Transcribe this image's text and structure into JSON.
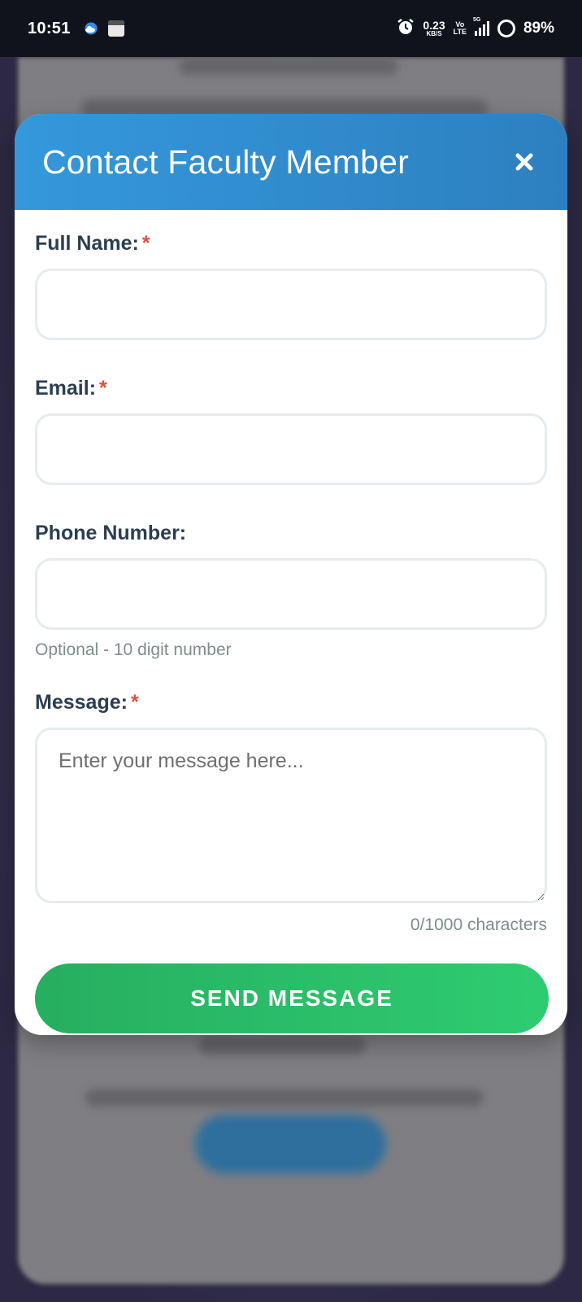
{
  "status_bar": {
    "time": "10:51",
    "net_speed_value": "0.23",
    "net_speed_unit": "KB/S",
    "volte_top": "Vo",
    "volte_bottom": "LTE",
    "signal_label": "5G",
    "battery": "89%",
    "icons": [
      "cloud-icon",
      "calendar-icon",
      "alarm-icon",
      "signal-icon",
      "battery-icon"
    ]
  },
  "modal": {
    "title": "Contact Faculty Member",
    "close_icon": "close-icon",
    "header_color": "#3498db",
    "fields": {
      "full_name": {
        "label": "Full Name:",
        "required_mark": "*",
        "value": ""
      },
      "email": {
        "label": "Email:",
        "required_mark": "*",
        "value": ""
      },
      "phone": {
        "label": "Phone Number:",
        "value": "",
        "hint": "Optional - 10 digit number"
      },
      "message": {
        "label": "Message:",
        "required_mark": "*",
        "placeholder": "Enter your message here...",
        "value": "",
        "counter": "0/1000 characters"
      }
    },
    "send_button": {
      "label": "SEND MESSAGE",
      "color": "#2ecc71"
    },
    "required_color": "#e74c3c"
  }
}
